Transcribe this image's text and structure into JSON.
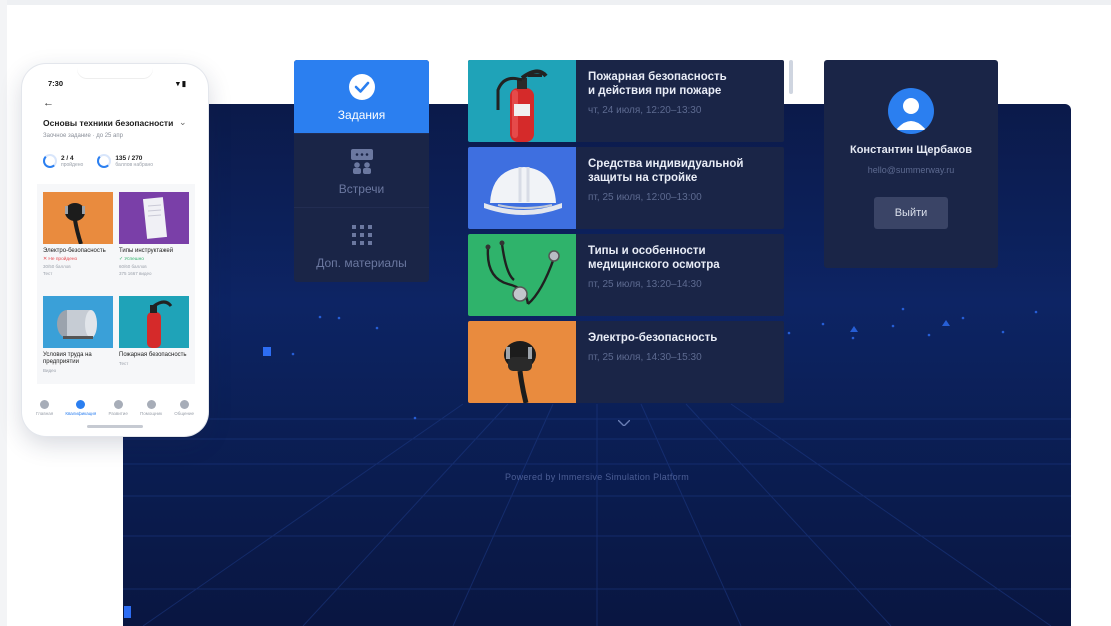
{
  "menu": {
    "items": [
      {
        "label": "Задания",
        "icon": "check-circle-icon",
        "active": true
      },
      {
        "label": "Встречи",
        "icon": "meeting-icon",
        "active": false
      },
      {
        "label": "Доп. материалы",
        "icon": "grid-dots-icon",
        "active": false
      }
    ]
  },
  "tasks": [
    {
      "title": "Пожарная безопасность\nи действия при пожаре",
      "time": "чт, 24 июля, 12:20–13:30",
      "thumb_color": "#1fa3b8",
      "icon": "fire-extinguisher-icon"
    },
    {
      "title": "Средства индивидуальной\nзащиты на стройке",
      "time": "пт, 25 июля, 12:00–13:00",
      "thumb_color": "#3e6fe0",
      "icon": "hard-hat-icon"
    },
    {
      "title": "Типы и особенности\nмедицинского осмотра",
      "time": "пт, 25 июля, 13:20–14:30",
      "thumb_color": "#2fb36b",
      "icon": "stethoscope-icon"
    },
    {
      "title": "Электро-безопасность",
      "time": "пт, 25 июля, 14:30–15:30",
      "thumb_color": "#e98b3e",
      "icon": "power-plug-icon"
    }
  ],
  "profile": {
    "name": "Константин Щербаков",
    "email": "hello@summerway.ru",
    "logout_label": "Выйти"
  },
  "scene": {
    "powered_by": "Powered by Immersive Simulation Platform"
  },
  "phone": {
    "time": "7:30",
    "signal": "▾ ▮",
    "title": "Основы техники безопасности",
    "subtitle": "Заочное задание · до 25 апр",
    "stats": [
      {
        "value": "2 / 4",
        "caption": "пройдено"
      },
      {
        "value": "135 / 270",
        "caption": "баллов набрано"
      }
    ],
    "cards": [
      {
        "name": "Электро-безопасность",
        "status": "✕ Не пройдено",
        "status_color": "#e5484d",
        "meta1": "30/50 баллов",
        "meta2": "Тест",
        "bg": "#e98b3e",
        "icon": "power-plug-icon"
      },
      {
        "name": "Типы инструктажей",
        "status": "✓ Успешно",
        "status_color": "#2fb36b",
        "meta1": "60/60 баллов",
        "meta2": "375 1667 видео",
        "bg": "#7a3fa8",
        "icon": "document-icon"
      },
      {
        "name": "Условия труда на предприятии",
        "status": "",
        "status_color": "#9aa0aa",
        "meta1": "Видео",
        "meta2": "",
        "bg": "#3aa0d8",
        "icon": "heater-icon"
      },
      {
        "name": "Пожарная безопасность",
        "status": "",
        "status_color": "#9aa0aa",
        "meta1": "Тест",
        "meta2": "",
        "bg": "#1fa3b8",
        "icon": "fire-extinguisher-icon"
      }
    ],
    "tabs": [
      {
        "label": "Главная",
        "active": false
      },
      {
        "label": "Квалификация",
        "active": true
      },
      {
        "label": "Развитие",
        "active": false
      },
      {
        "label": "Помощник",
        "active": false
      },
      {
        "label": "Общение",
        "active": false
      }
    ]
  },
  "colors": {
    "accent": "#2b7ff0",
    "panel": "#1a2547",
    "scene_top": "#0d2464"
  }
}
